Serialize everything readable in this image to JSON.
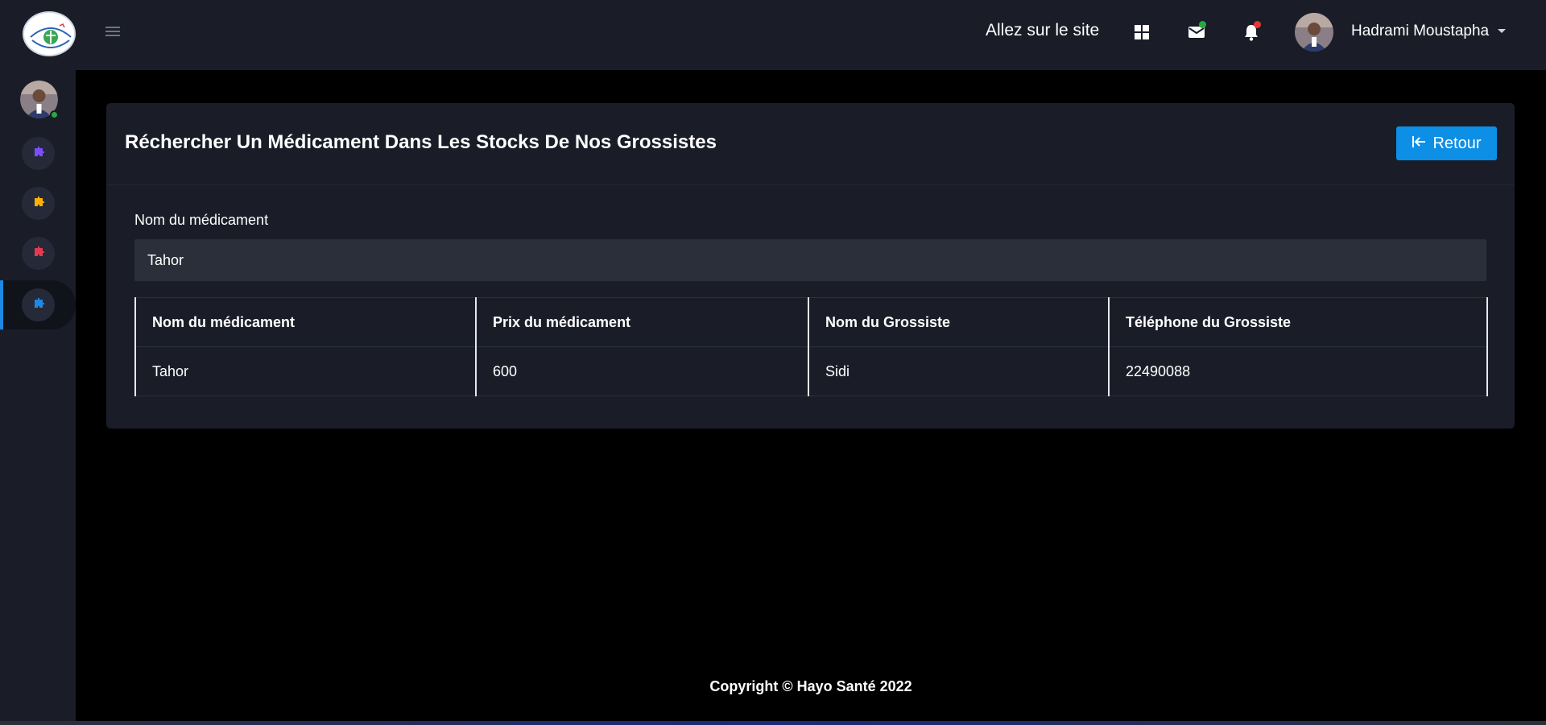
{
  "header": {
    "site_link": "Allez sur le site",
    "user_name": "Hadrami Moustapha",
    "icons": [
      "apps-grid-icon",
      "mail-icon",
      "bell-icon"
    ],
    "mail_dot_color": "#28a745",
    "bell_dot_color": "#e53935"
  },
  "sidebar": {
    "items": [
      {
        "icon": "puzzle-icon",
        "color": "#7c4dff"
      },
      {
        "icon": "puzzle-icon",
        "color": "#ffb300"
      },
      {
        "icon": "puzzle-icon",
        "color": "#e53950"
      },
      {
        "icon": "puzzle-icon",
        "color": "#1e88e5",
        "active": true
      }
    ],
    "accent": "#1e88e5"
  },
  "card": {
    "title": "Réchercher Un Médicament Dans Les Stocks De Nos Grossistes",
    "back_button": "Retour",
    "search_label": "Nom du médicament",
    "search_value": "Tahor"
  },
  "table": {
    "columns": [
      "Nom du médicament",
      "Prix du médicament",
      "Nom du Grossiste",
      "Téléphone du Grossiste"
    ],
    "rows": [
      [
        "Tahor",
        "600",
        "Sidi",
        "22490088"
      ]
    ]
  },
  "footer": {
    "text": "Copyright © Hayo Santé 2022"
  }
}
